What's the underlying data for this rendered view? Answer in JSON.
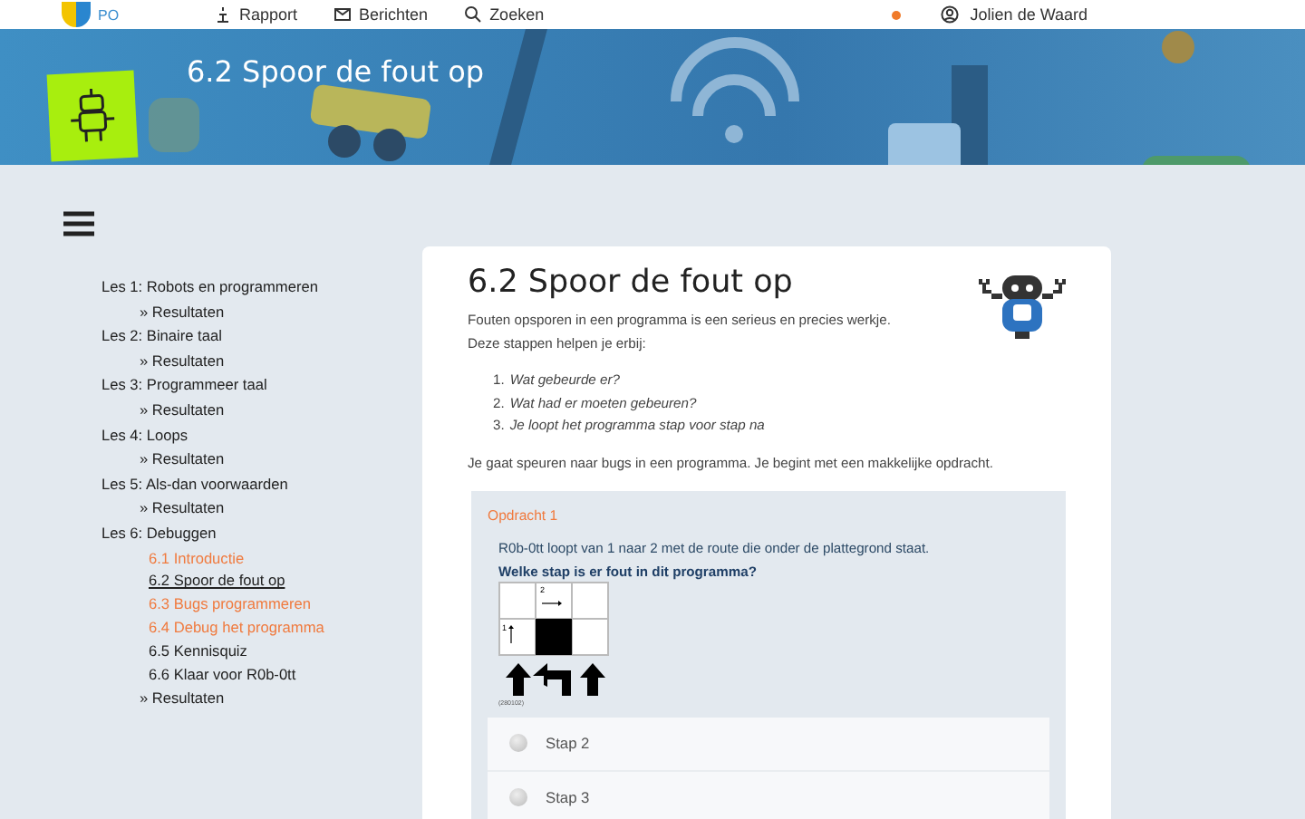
{
  "header": {
    "logo_text": "PO",
    "nav": [
      {
        "label": "Rapport"
      },
      {
        "label": "Berichten"
      },
      {
        "label": "Zoeken"
      }
    ],
    "user": "Jolien de Waard"
  },
  "banner": {
    "title": "6.2 Spoor de fout op"
  },
  "sidebar": {
    "lessons": [
      {
        "label": "Les 1: Robots en programmeren",
        "results": "» Resultaten"
      },
      {
        "label": "Les 2: Binaire taal",
        "results": "» Resultaten"
      },
      {
        "label": "Les 3: Programmeer taal",
        "results": "» Resultaten"
      },
      {
        "label": "Les 4: Loops",
        "results": "» Resultaten"
      },
      {
        "label": "Les 5: Als-dan voorwaarden",
        "results": "» Resultaten"
      },
      {
        "label": "Les 6: Debuggen",
        "children": [
          {
            "label": "6.1 Introductie",
            "selected": false,
            "completed": true
          },
          {
            "label": "6.2 Spoor de fout op",
            "selected": true,
            "completed": false
          },
          {
            "label": "6.3 Bugs programmeren",
            "selected": false,
            "completed": true
          },
          {
            "label": "6.4 Debug het programma",
            "selected": false,
            "completed": true
          },
          {
            "label": "6.5 Kennisquiz",
            "selected": false,
            "completed": false
          },
          {
            "label": "6.6 Klaar voor R0b-0tt",
            "selected": false,
            "completed": false
          }
        ],
        "results": "» Resultaten"
      }
    ]
  },
  "lesson": {
    "title": "6.2 Spoor de fout op",
    "intro": [
      "Fouten opsporen in een programma is een serieus en precies werkje.",
      "Deze stappen helpen je erbij:"
    ],
    "steps": [
      {
        "number": "1.",
        "text": "Wat gebeurde er?"
      },
      {
        "number": "2.",
        "text": "Wat had er moeten gebeuren?"
      },
      {
        "number": "3.",
        "text": "Je loopt het programma stap voor stap na"
      }
    ],
    "outro": "Je gaat speuren naar bugs in een programma. Je begint met een makkelijke opdracht.",
    "exercise": {
      "label": "Opdracht 1",
      "text": "R0b-0tt loopt van 1 naar 2 met de route die onder de plattegrond staat.",
      "question": "Welke stap is er fout in dit programma?",
      "grid_labels": [
        "2",
        "1"
      ],
      "code": "(280102)",
      "options": [
        {
          "label": "Stap 2",
          "selected": false
        },
        {
          "label": "Stap 3",
          "selected": false
        }
      ]
    }
  }
}
